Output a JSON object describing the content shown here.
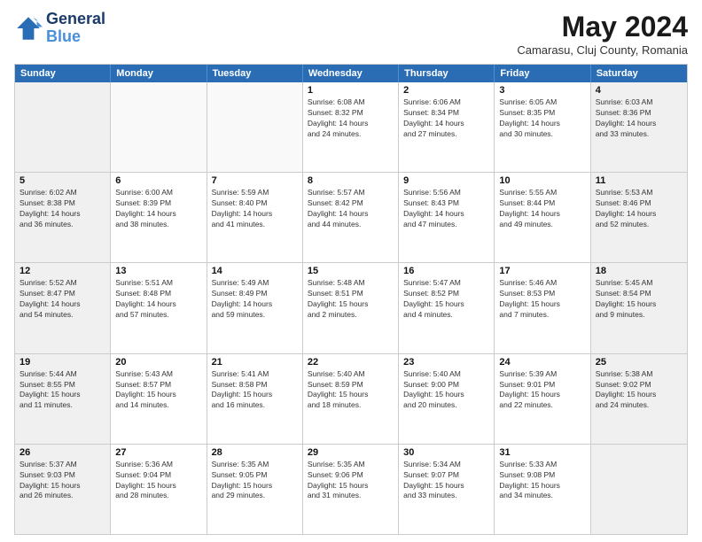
{
  "header": {
    "logo_line1": "General",
    "logo_line2": "Blue",
    "month_title": "May 2024",
    "location": "Camarasu, Cluj County, Romania"
  },
  "days_of_week": [
    "Sunday",
    "Monday",
    "Tuesday",
    "Wednesday",
    "Thursday",
    "Friday",
    "Saturday"
  ],
  "weeks": [
    [
      {
        "day": "",
        "info": "",
        "empty": true
      },
      {
        "day": "",
        "info": "",
        "empty": true
      },
      {
        "day": "",
        "info": "",
        "empty": true
      },
      {
        "day": "1",
        "info": "Sunrise: 6:08 AM\nSunset: 8:32 PM\nDaylight: 14 hours\nand 24 minutes."
      },
      {
        "day": "2",
        "info": "Sunrise: 6:06 AM\nSunset: 8:34 PM\nDaylight: 14 hours\nand 27 minutes."
      },
      {
        "day": "3",
        "info": "Sunrise: 6:05 AM\nSunset: 8:35 PM\nDaylight: 14 hours\nand 30 minutes."
      },
      {
        "day": "4",
        "info": "Sunrise: 6:03 AM\nSunset: 8:36 PM\nDaylight: 14 hours\nand 33 minutes."
      }
    ],
    [
      {
        "day": "5",
        "info": "Sunrise: 6:02 AM\nSunset: 8:38 PM\nDaylight: 14 hours\nand 36 minutes."
      },
      {
        "day": "6",
        "info": "Sunrise: 6:00 AM\nSunset: 8:39 PM\nDaylight: 14 hours\nand 38 minutes."
      },
      {
        "day": "7",
        "info": "Sunrise: 5:59 AM\nSunset: 8:40 PM\nDaylight: 14 hours\nand 41 minutes."
      },
      {
        "day": "8",
        "info": "Sunrise: 5:57 AM\nSunset: 8:42 PM\nDaylight: 14 hours\nand 44 minutes."
      },
      {
        "day": "9",
        "info": "Sunrise: 5:56 AM\nSunset: 8:43 PM\nDaylight: 14 hours\nand 47 minutes."
      },
      {
        "day": "10",
        "info": "Sunrise: 5:55 AM\nSunset: 8:44 PM\nDaylight: 14 hours\nand 49 minutes."
      },
      {
        "day": "11",
        "info": "Sunrise: 5:53 AM\nSunset: 8:46 PM\nDaylight: 14 hours\nand 52 minutes."
      }
    ],
    [
      {
        "day": "12",
        "info": "Sunrise: 5:52 AM\nSunset: 8:47 PM\nDaylight: 14 hours\nand 54 minutes."
      },
      {
        "day": "13",
        "info": "Sunrise: 5:51 AM\nSunset: 8:48 PM\nDaylight: 14 hours\nand 57 minutes."
      },
      {
        "day": "14",
        "info": "Sunrise: 5:49 AM\nSunset: 8:49 PM\nDaylight: 14 hours\nand 59 minutes."
      },
      {
        "day": "15",
        "info": "Sunrise: 5:48 AM\nSunset: 8:51 PM\nDaylight: 15 hours\nand 2 minutes."
      },
      {
        "day": "16",
        "info": "Sunrise: 5:47 AM\nSunset: 8:52 PM\nDaylight: 15 hours\nand 4 minutes."
      },
      {
        "day": "17",
        "info": "Sunrise: 5:46 AM\nSunset: 8:53 PM\nDaylight: 15 hours\nand 7 minutes."
      },
      {
        "day": "18",
        "info": "Sunrise: 5:45 AM\nSunset: 8:54 PM\nDaylight: 15 hours\nand 9 minutes."
      }
    ],
    [
      {
        "day": "19",
        "info": "Sunrise: 5:44 AM\nSunset: 8:55 PM\nDaylight: 15 hours\nand 11 minutes."
      },
      {
        "day": "20",
        "info": "Sunrise: 5:43 AM\nSunset: 8:57 PM\nDaylight: 15 hours\nand 14 minutes."
      },
      {
        "day": "21",
        "info": "Sunrise: 5:41 AM\nSunset: 8:58 PM\nDaylight: 15 hours\nand 16 minutes."
      },
      {
        "day": "22",
        "info": "Sunrise: 5:40 AM\nSunset: 8:59 PM\nDaylight: 15 hours\nand 18 minutes."
      },
      {
        "day": "23",
        "info": "Sunrise: 5:40 AM\nSunset: 9:00 PM\nDaylight: 15 hours\nand 20 minutes."
      },
      {
        "day": "24",
        "info": "Sunrise: 5:39 AM\nSunset: 9:01 PM\nDaylight: 15 hours\nand 22 minutes."
      },
      {
        "day": "25",
        "info": "Sunrise: 5:38 AM\nSunset: 9:02 PM\nDaylight: 15 hours\nand 24 minutes."
      }
    ],
    [
      {
        "day": "26",
        "info": "Sunrise: 5:37 AM\nSunset: 9:03 PM\nDaylight: 15 hours\nand 26 minutes."
      },
      {
        "day": "27",
        "info": "Sunrise: 5:36 AM\nSunset: 9:04 PM\nDaylight: 15 hours\nand 28 minutes."
      },
      {
        "day": "28",
        "info": "Sunrise: 5:35 AM\nSunset: 9:05 PM\nDaylight: 15 hours\nand 29 minutes."
      },
      {
        "day": "29",
        "info": "Sunrise: 5:35 AM\nSunset: 9:06 PM\nDaylight: 15 hours\nand 31 minutes."
      },
      {
        "day": "30",
        "info": "Sunrise: 5:34 AM\nSunset: 9:07 PM\nDaylight: 15 hours\nand 33 minutes."
      },
      {
        "day": "31",
        "info": "Sunrise: 5:33 AM\nSunset: 9:08 PM\nDaylight: 15 hours\nand 34 minutes."
      },
      {
        "day": "",
        "info": "",
        "empty": true
      }
    ]
  ]
}
